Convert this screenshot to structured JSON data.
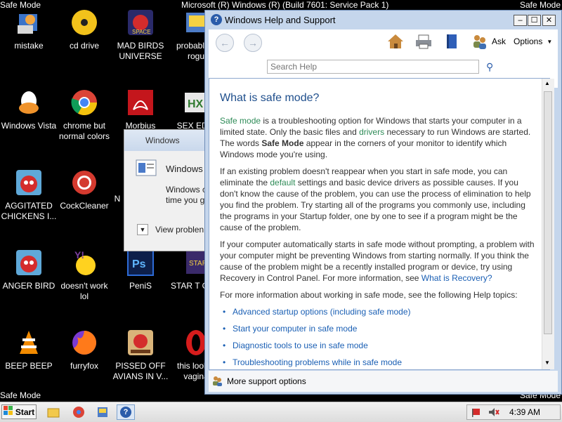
{
  "desktop": {
    "corner_top_left": "Safe Mode",
    "corner_top_right": "Safe Mode",
    "corner_bottom_left": "Safe Mode",
    "corner_bottom_right": "Safe Mode",
    "top_caption": "Microsoft (R) Windows (R) (Build 7601: Service Pack 1)",
    "icons": {
      "mistake": "mistake",
      "cd_drive": "cd drive",
      "mad_birds": "MAD BIRDS UNIVERSE",
      "probably": "probably a rogu",
      "windows_vista": "Windows Vista",
      "chrome": "chrome but normal colors",
      "morbius": "Morbius",
      "sex_edit": "SEX EDIT",
      "agitated": "AGGITATED CHICKENS I...",
      "cockcleaner": "CockCleaner",
      "n_icon": "N",
      "anger_bird": "ANGER BIRD",
      "doesnt_work": "doesn't work lol",
      "penis": "PeniS",
      "star_game": "STAR T GAM",
      "beep_beep": "BEEP BEEP",
      "furryfox": "furryfox",
      "pissed_off": "PISSED OFF AVIANS IN V...",
      "this_look": "this look a vagina"
    }
  },
  "bg_dialog": {
    "title": "Windows",
    "line1": "Windows h",
    "line2a": "Windows c",
    "line2b": "time you g",
    "view_problem": "View problen"
  },
  "help": {
    "title": "Windows Help and Support",
    "toolbar": {
      "ask": "Ask",
      "options": "Options"
    },
    "search_placeholder": "Search Help",
    "heading": "What is safe mode?",
    "p1_link": "Safe mode",
    "p1_a": " is a troubleshooting option for Windows that starts your computer in a limited state. Only the basic files and ",
    "p1_link2": "drivers",
    "p1_b": " necessary to run Windows are started. The words ",
    "p1_bold": "Safe Mode",
    "p1_c": " appear in the corners of your monitor to identify which Windows mode you're using.",
    "p2_a": "If an existing problem doesn't reappear when you start in safe mode, you can eliminate the ",
    "p2_link": "default",
    "p2_b": " settings and basic device drivers as possible causes. If you don't know the cause of the problem, you can use the process of elimination to help you find the problem. Try starting all of the programs you commonly use, including the programs in your Startup folder, one by one to see if a program might be the cause of the problem.",
    "p3_a": "If your computer automatically starts in safe mode without prompting, a problem with your computer might be preventing Windows from starting normally. If you think the cause of the problem might be a recently installed program or device, try using Recovery in Control Panel. For more information, see ",
    "p3_link": "What is Recovery?",
    "p4": "For more information about working in safe mode, see the following Help topics:",
    "topics": [
      "Advanced startup options (including safe mode)",
      "Start your computer in safe mode",
      "Diagnostic tools to use in safe mode",
      "Troubleshooting problems while in safe mode"
    ],
    "footer": "More support options"
  },
  "taskbar": {
    "start": "Start",
    "clock": "4:39 AM"
  }
}
